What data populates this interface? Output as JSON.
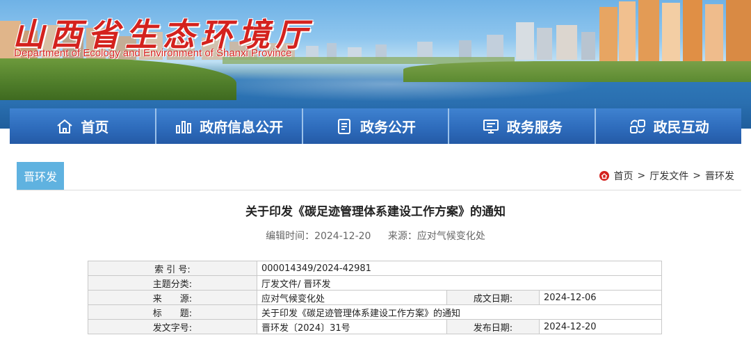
{
  "header": {
    "title": "山西省生态环境厅",
    "subtitle": "Department of Ecology and Environment of Shanxi Province"
  },
  "nav": {
    "items": [
      {
        "label": "首页",
        "icon": "home-icon"
      },
      {
        "label": "政府信息公开",
        "icon": "bar-chart-icon"
      },
      {
        "label": "政务公开",
        "icon": "document-list-icon"
      },
      {
        "label": "政务服务",
        "icon": "monitor-icon"
      },
      {
        "label": "政民互动",
        "icon": "interaction-icon"
      }
    ]
  },
  "category": "晋环发",
  "breadcrumb": {
    "items": [
      "首页",
      "厅发文件",
      "晋环发"
    ],
    "separator": ">"
  },
  "article": {
    "title": "关于印发《碳足迹管理体系建设工作方案》的通知",
    "edit_time_label": "编辑时间：",
    "edit_time": "2024-12-20",
    "source_label": "来源：",
    "source": "应对气候变化处"
  },
  "info_table": {
    "index_label": "索 引 号:",
    "index_value": "000014349/2024-42981",
    "topic_label": "主题分类:",
    "topic_value": "厅发文件/ 晋环发",
    "source_label": "来　　源:",
    "source_value": "应对气候变化处",
    "written_date_label": "成文日期:",
    "written_date_value": "2024-12-06",
    "title_label": "标　　题:",
    "title_value": "关于印发《碳足迹管理体系建设工作方案》的通知",
    "doc_no_label": "发文字号:",
    "doc_no_value": "晋环发〔2024〕31号",
    "publish_date_label": "发布日期:",
    "publish_date_value": "2024-12-20"
  },
  "colors": {
    "nav_bg": "#2e6cbc",
    "title_red": "#d4221e",
    "category_tab": "#5fb2e0"
  }
}
